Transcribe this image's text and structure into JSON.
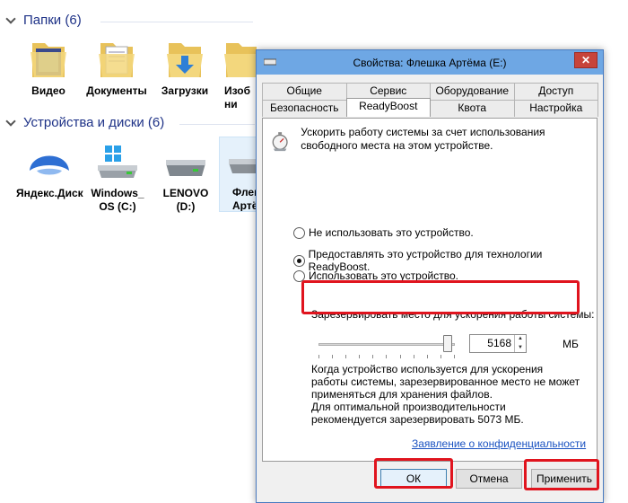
{
  "explorer": {
    "folders_header": "Папки (6)",
    "devices_header": "Устройства и диски (6)",
    "folders": [
      {
        "label": "Видео",
        "icon": "video-folder-icon"
      },
      {
        "label": "Документы",
        "icon": "documents-folder-icon"
      },
      {
        "label": "Загрузки",
        "icon": "downloads-folder-icon"
      },
      {
        "label": "Изоб ни",
        "icon": "pictures-folder-icon"
      },
      {
        "label": "",
        "icon": "music-folder-icon"
      },
      {
        "label": "",
        "icon": "desktop-folder-icon"
      }
    ],
    "devices": [
      {
        "label": "Яндекс.Диск",
        "icon": "yandex-disk-icon"
      },
      {
        "label": "Windows_ OS (C:)",
        "icon": "windows-drive-icon"
      },
      {
        "label": "LENOVO (D:)",
        "icon": "hard-drive-icon"
      },
      {
        "label": "Флеш Артём",
        "icon": "flash-drive-icon"
      }
    ]
  },
  "dialog": {
    "title": "Свойства: Флешка Артёма (E:)",
    "close_label": "✕",
    "tabs_back": [
      "Общие",
      "Сервис",
      "Оборудование",
      "Доступ"
    ],
    "tabs_front": [
      "Безопасность",
      "ReadyBoost",
      "Квота",
      "Настройка"
    ],
    "active_tab": "ReadyBoost",
    "intro_text": "Ускорить работу системы за счет использования свободного места на этом устройстве.",
    "options": [
      {
        "label": "Не использовать это устройство.",
        "selected": false
      },
      {
        "label": "Предоставлять это устройство для технологии ReadyBoost.",
        "selected": true
      },
      {
        "label": "Использовать это устройство.",
        "selected": false
      }
    ],
    "reserve_label": "Зарезервировать место для ускорения работы системы:",
    "slider_fraction": 0.95,
    "reserve_value": "5168",
    "unit": "МБ",
    "description": "Когда устройство используется для ускорения работы системы, зарезервированное место не может применяться для хранения файлов.",
    "recommendation": "Для оптимальной производительности рекомендуется зарезервировать 5073 МБ.",
    "privacy_link": "Заявление о конфиденциальности",
    "buttons": {
      "ok": "ОК",
      "cancel": "Отмена",
      "apply": "Применить"
    },
    "highlight_color": "#e0141e"
  }
}
